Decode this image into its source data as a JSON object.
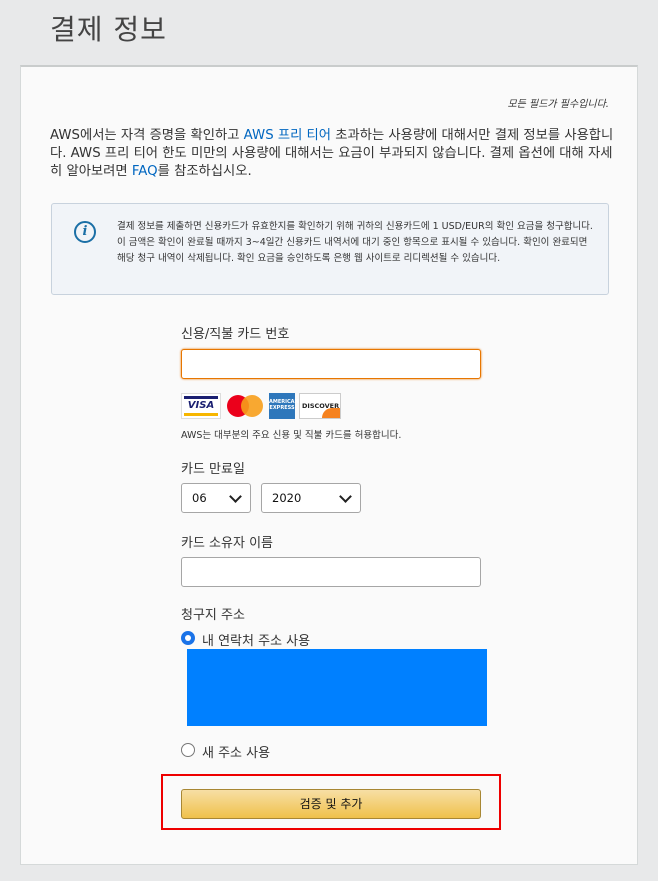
{
  "page_title": "결제 정보",
  "required_note": "모든 필드가 필수입니다.",
  "intro": {
    "part1": "AWS에서는 자격 증명을 확인하고 ",
    "free_tier_link": "AWS 프리 티어",
    "part2": " 초과하는 사용량에 대해서만 결제 정보를 사용합니다. AWS 프리 티어 한도 미만의 사용량에 대해서는 요금이 부과되지 않습니다. 결제 옵션에 대해 자세히 알아보려면 ",
    "faq_link": "FAQ",
    "part3": "를 참조하십시오."
  },
  "info_box": {
    "icon": "info-icon",
    "text": "결제 정보를 제출하면 신용카드가 유효한지를 확인하기 위해 귀하의 신용카드에 1 USD/EUR의 확인 요금을 청구합니다. 이 금액은 확인이 완료될 때까지 3~4일간 신용카드 내역서에 대기 중인 항목으로 표시될 수 있습니다. 확인이 완료되면 해당 청구 내역이 삭제됩니다. 확인 요금을 승인하도록 은행 웹 사이트로 리디렉션될 수 있습니다."
  },
  "card_number": {
    "label": "신용/직불 카드 번호",
    "value": ""
  },
  "card_logos": {
    "visa": "VISA",
    "amex": "AMERICAN EXPRESS",
    "discover": "DISCOVER"
  },
  "card_accept_note": "AWS는 대부분의 주요 신용 및 직불 카드를 허용합니다.",
  "expiry": {
    "label": "카드 만료일",
    "month": "06",
    "year": "2020"
  },
  "cardholder": {
    "label": "카드 소유자 이름",
    "value": ""
  },
  "billing_address": {
    "label": "청구지 주소",
    "option_contact": "내 연락처 주소 사용",
    "option_new": "새 주소 사용"
  },
  "submit_label": "검증 및 추가",
  "colors": {
    "link": "#0066c0",
    "button": "#f0c14b",
    "address_block": "#0080ff",
    "highlight": "#e00000"
  }
}
